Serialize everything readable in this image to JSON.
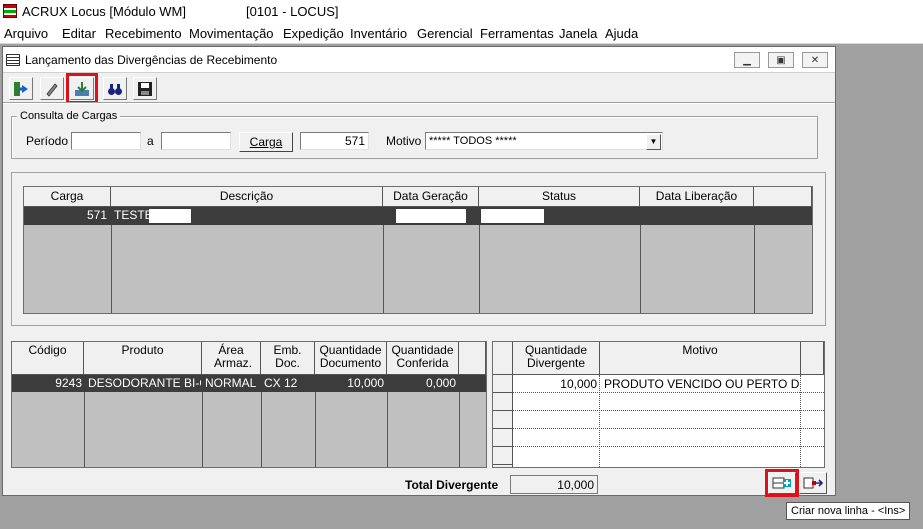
{
  "app": {
    "title": "ACRUX Locus [Módulo WM]",
    "company": "[0101 - LOCUS]"
  },
  "menu": [
    "Arquivo",
    "Editar",
    "Recebimento",
    "Movimentação",
    "Expedição",
    "Inventário",
    "Gerencial",
    "Ferramentas",
    "Janela",
    "Ajuda"
  ],
  "window": {
    "title": "Lançamento das Divergências de Recebimento"
  },
  "toolbar": {
    "icons": [
      "exit-icon",
      "edit-pencil-icon",
      "import-icon",
      "binoculars-search-icon",
      "save-disk-icon"
    ],
    "highlighted": "import-icon"
  },
  "consulta": {
    "group_label": "Consulta de Cargas",
    "periodo_label": "Período",
    "periodo_from": "",
    "periodo_sep": "a",
    "periodo_to": "",
    "carga_button": "Carga",
    "carga_value": "571",
    "motivo_label": "Motivo",
    "motivo_value": "***** TODOS *****"
  },
  "cargas_grid": {
    "headers": [
      "Carga",
      "Descrição",
      "Data Geração",
      "Status",
      "Data Liberação"
    ],
    "rows": [
      {
        "carga": "571",
        "descricao": "TESTE",
        "data_geracao": "",
        "status": "",
        "data_liberacao": ""
      }
    ]
  },
  "produtos_grid": {
    "headers": [
      "Código",
      "Produto",
      "Área Armaz.",
      "Emb. Doc.",
      "Quantidade Documento",
      "Quantidade Conferida"
    ],
    "rows": [
      {
        "codigo": "9243",
        "produto": "DESODORANTE BI-O F",
        "area": "NORMAL",
        "emb": "CX 12",
        "qtd_doc": "10,000",
        "qtd_conf": "0,000"
      }
    ]
  },
  "divergencia_grid": {
    "headers": [
      "Quantidade Divergente",
      "Motivo"
    ],
    "rows": [
      {
        "qtd": "10,000",
        "motivo": "PRODUTO VENCIDO OU PERTO DO VE"
      }
    ]
  },
  "total": {
    "label": "Total Divergente",
    "value": "10,000"
  },
  "tooltip": "Criar nova linha - <Ins>",
  "colors": {
    "highlight": "#e0101a",
    "selected_row": "#3c3c3c",
    "grid_bg": "#c0c0c0",
    "window_bg": "#f0f0f0",
    "desktop_bg": "#a0a0a0"
  }
}
